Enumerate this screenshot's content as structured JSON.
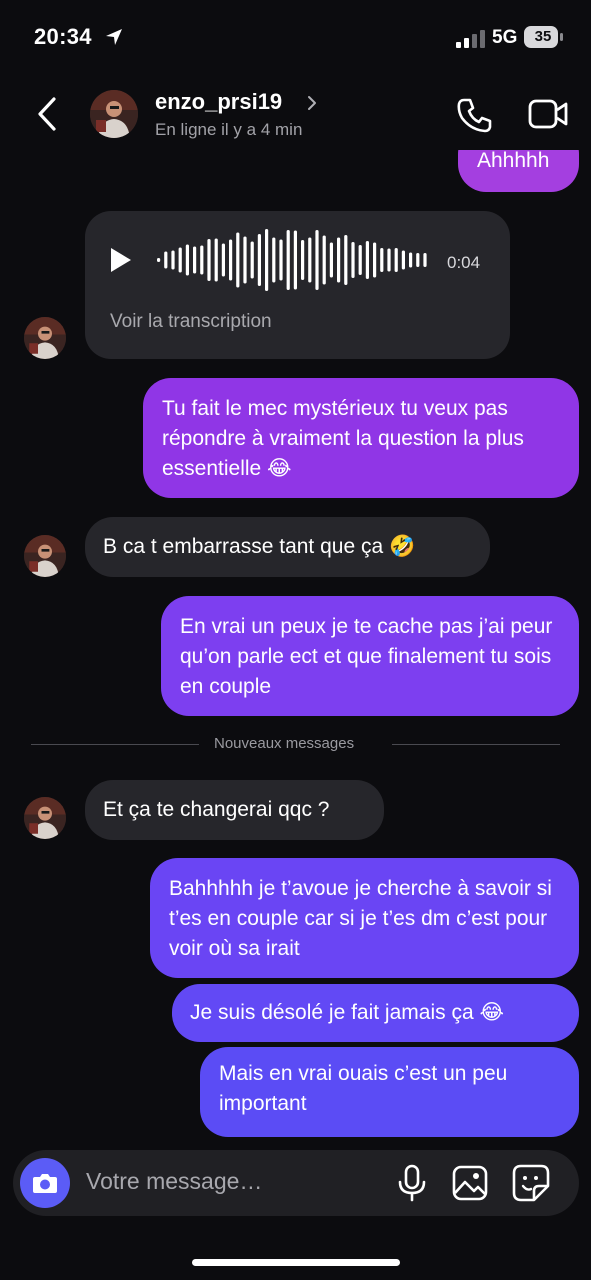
{
  "status_bar": {
    "time": "20:34",
    "network": "5G",
    "battery": "35"
  },
  "header": {
    "contact_name": "enzo_prsi19",
    "contact_status": "En ligne il y a 4 min"
  },
  "chat": {
    "partial_message": "Ahhhhh",
    "voice_message": {
      "duration": "0:04",
      "transcript_link": "Voir la transcription"
    },
    "messages": [
      {
        "text": "Tu fait le mec mystérieux tu veux pas répondre à vraiment la question la plus essentielle 😂"
      },
      {
        "text": "B ca t embarrasse tant que ça 🤣"
      },
      {
        "text": "En vrai un peux je te cache pas j’ai peur qu’on parle ect et que finalement tu sois en couple"
      },
      {
        "text": "Et ça te changerai qqc ?"
      },
      {
        "text": "Bahhhhh je t’avoue je cherche à savoir si t’es en couple car si je t’es dm c’est pour voir où sa irait"
      },
      {
        "text": "Je suis désolé je fait jamais ça 😂"
      },
      {
        "text": "Mais en vrai ouais c’est un peu important"
      }
    ],
    "divider_label": "Nouveaux messages"
  },
  "composer": {
    "placeholder": "Votre message…"
  },
  "colors": {
    "background": "#0c0c0f",
    "incoming_bubble": "#26262b",
    "outgoing_purple": "#8d35e8",
    "outgoing_indigo": "#5d4cf5",
    "camera_button": "#5b5cf6"
  }
}
